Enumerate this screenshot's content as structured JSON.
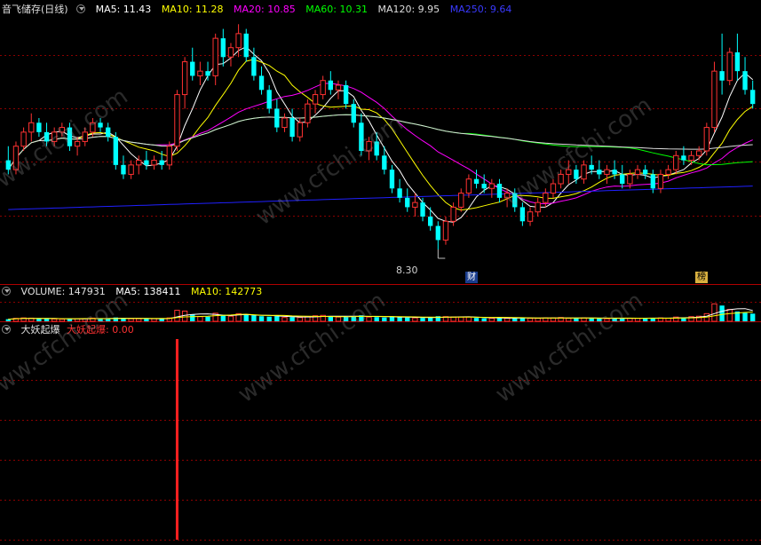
{
  "main_panel": {
    "title": "音飞储存(日线)",
    "ma": [
      {
        "label": "MA5: 11.43",
        "color": "#ffffff"
      },
      {
        "label": "MA10: 11.28",
        "color": "#ffff00"
      },
      {
        "label": "MA20: 10.85",
        "color": "#ff00ff"
      },
      {
        "label": "MA60: 10.31",
        "color": "#00ff00"
      },
      {
        "label": "MA120: 9.95",
        "color": "#dddddd"
      },
      {
        "label": "MA250: 9.64",
        "color": "#2020ff"
      }
    ],
    "low_marker": "8.30",
    "badges": [
      {
        "text": "财"
      },
      {
        "text": "榜"
      }
    ]
  },
  "volume_panel": {
    "label": "VOLUME: 147931",
    "ma5": "MA5: 138411",
    "ma10": "MA10: 142773"
  },
  "indicator_panel": {
    "name": "大妖起爆",
    "value_label": "大妖起爆: 0.00"
  },
  "watermark": "www.cfchi.com",
  "colors": {
    "up": "#ff3232",
    "down": "#00ffff",
    "grid": "#8b0000",
    "ma5": "#ffffff",
    "ma10": "#ffff00",
    "ma20": "#ff00ff",
    "ma60": "#00ff00",
    "ma120": "#dddddd",
    "ma250": "#2020ff"
  },
  "chart_data": {
    "type": "candlestick",
    "price_range": [
      7.6,
      13.2
    ],
    "candles": [
      [
        10.2,
        10.5,
        9.9,
        10.0
      ],
      [
        10.0,
        10.6,
        9.9,
        10.5
      ],
      [
        10.5,
        10.9,
        10.4,
        10.8
      ],
      [
        10.8,
        11.2,
        10.6,
        11.0
      ],
      [
        11.0,
        11.1,
        10.7,
        10.8
      ],
      [
        10.8,
        11.0,
        10.5,
        10.6
      ],
      [
        10.6,
        10.9,
        10.5,
        10.8
      ],
      [
        10.8,
        11.0,
        10.7,
        10.9
      ],
      [
        10.9,
        11.0,
        10.4,
        10.5
      ],
      [
        10.5,
        10.7,
        10.3,
        10.6
      ],
      [
        10.6,
        10.9,
        10.5,
        10.8
      ],
      [
        10.8,
        11.1,
        10.7,
        11.0
      ],
      [
        11.0,
        11.1,
        10.8,
        10.9
      ],
      [
        10.9,
        11.0,
        10.6,
        10.7
      ],
      [
        10.7,
        10.8,
        10.0,
        10.1
      ],
      [
        10.1,
        10.3,
        9.8,
        9.9
      ],
      [
        9.9,
        10.2,
        9.8,
        10.1
      ],
      [
        10.1,
        10.3,
        9.9,
        10.2
      ],
      [
        10.2,
        10.4,
        10.0,
        10.1
      ],
      [
        10.1,
        10.3,
        10.0,
        10.2
      ],
      [
        10.2,
        10.4,
        10.0,
        10.1
      ],
      [
        10.1,
        10.6,
        10.0,
        10.5
      ],
      [
        10.5,
        11.7,
        10.4,
        11.6
      ],
      [
        11.6,
        12.4,
        11.3,
        12.3
      ],
      [
        12.3,
        12.6,
        11.9,
        12.0
      ],
      [
        12.0,
        12.3,
        11.8,
        12.1
      ],
      [
        12.1,
        12.3,
        11.9,
        12.0
      ],
      [
        12.0,
        12.9,
        11.8,
        12.8
      ],
      [
        12.8,
        13.0,
        12.2,
        12.4
      ],
      [
        12.4,
        12.7,
        12.2,
        12.6
      ],
      [
        12.6,
        13.1,
        12.4,
        12.9
      ],
      [
        12.9,
        13.0,
        12.3,
        12.4
      ],
      [
        12.4,
        12.6,
        11.9,
        12.0
      ],
      [
        12.0,
        12.2,
        11.6,
        11.7
      ],
      [
        11.7,
        11.8,
        11.2,
        11.3
      ],
      [
        11.3,
        11.5,
        10.8,
        10.9
      ],
      [
        10.9,
        11.2,
        10.8,
        11.1
      ],
      [
        11.1,
        11.3,
        10.6,
        10.7
      ],
      [
        10.7,
        11.1,
        10.6,
        11.0
      ],
      [
        11.0,
        11.5,
        10.9,
        11.4
      ],
      [
        11.4,
        11.7,
        11.2,
        11.6
      ],
      [
        11.6,
        12.0,
        11.5,
        11.9
      ],
      [
        11.9,
        12.1,
        11.6,
        11.7
      ],
      [
        11.7,
        11.9,
        11.5,
        11.8
      ],
      [
        11.8,
        11.9,
        11.3,
        11.4
      ],
      [
        11.4,
        11.5,
        10.9,
        11.0
      ],
      [
        11.0,
        11.2,
        10.3,
        10.4
      ],
      [
        10.4,
        10.7,
        10.2,
        10.6
      ],
      [
        10.6,
        10.8,
        10.2,
        10.3
      ],
      [
        10.3,
        10.5,
        9.9,
        10.0
      ],
      [
        10.0,
        10.1,
        9.5,
        9.6
      ],
      [
        9.6,
        9.8,
        9.3,
        9.4
      ],
      [
        9.4,
        9.6,
        9.1,
        9.2
      ],
      [
        9.2,
        9.5,
        9.0,
        9.3
      ],
      [
        9.3,
        9.4,
        8.9,
        9.0
      ],
      [
        9.0,
        9.2,
        8.7,
        8.8
      ],
      [
        8.8,
        8.9,
        8.3,
        8.5
      ],
      [
        8.5,
        9.0,
        8.4,
        8.9
      ],
      [
        8.9,
        9.3,
        8.8,
        9.2
      ],
      [
        9.2,
        9.6,
        9.1,
        9.5
      ],
      [
        9.5,
        9.9,
        9.4,
        9.8
      ],
      [
        9.8,
        10.0,
        9.6,
        9.7
      ],
      [
        9.7,
        9.9,
        9.5,
        9.6
      ],
      [
        9.6,
        9.8,
        9.4,
        9.7
      ],
      [
        9.7,
        9.8,
        9.3,
        9.4
      ],
      [
        9.4,
        9.6,
        9.2,
        9.5
      ],
      [
        9.5,
        9.6,
        9.1,
        9.2
      ],
      [
        9.2,
        9.3,
        8.8,
        8.9
      ],
      [
        8.9,
        9.2,
        8.8,
        9.1
      ],
      [
        9.1,
        9.4,
        9.0,
        9.3
      ],
      [
        9.3,
        9.6,
        9.2,
        9.5
      ],
      [
        9.5,
        9.8,
        9.4,
        9.7
      ],
      [
        9.7,
        10.0,
        9.6,
        9.9
      ],
      [
        9.9,
        10.2,
        9.7,
        10.0
      ],
      [
        10.0,
        10.1,
        9.7,
        9.8
      ],
      [
        9.8,
        10.2,
        9.7,
        10.1
      ],
      [
        10.1,
        10.3,
        9.9,
        10.0
      ],
      [
        10.0,
        10.2,
        9.8,
        9.9
      ],
      [
        9.9,
        10.1,
        9.7,
        10.0
      ],
      [
        10.0,
        10.2,
        9.8,
        9.9
      ],
      [
        9.9,
        10.1,
        9.6,
        9.7
      ],
      [
        9.7,
        10.0,
        9.6,
        9.9
      ],
      [
        9.9,
        10.1,
        9.8,
        10.0
      ],
      [
        10.0,
        10.1,
        9.8,
        9.9
      ],
      [
        9.9,
        10.0,
        9.5,
        9.6
      ],
      [
        9.6,
        10.0,
        9.5,
        9.9
      ],
      [
        9.9,
        10.1,
        9.8,
        10.0
      ],
      [
        10.0,
        10.4,
        9.9,
        10.3
      ],
      [
        10.3,
        10.5,
        10.1,
        10.2
      ],
      [
        10.2,
        10.4,
        10.1,
        10.3
      ],
      [
        10.3,
        10.5,
        10.2,
        10.4
      ],
      [
        10.4,
        11.0,
        10.3,
        10.9
      ],
      [
        10.9,
        12.3,
        10.8,
        12.1
      ],
      [
        12.1,
        12.9,
        11.6,
        11.9
      ],
      [
        11.9,
        12.6,
        11.8,
        12.5
      ],
      [
        12.5,
        12.9,
        11.9,
        12.1
      ],
      [
        12.1,
        12.4,
        11.6,
        11.7
      ],
      [
        11.7,
        11.9,
        11.3,
        11.4
      ]
    ],
    "volume_ratio": [
      0.1,
      0.14,
      0.16,
      0.15,
      0.12,
      0.12,
      0.11,
      0.1,
      0.14,
      0.12,
      0.12,
      0.15,
      0.12,
      0.14,
      0.18,
      0.14,
      0.12,
      0.12,
      0.12,
      0.12,
      0.12,
      0.16,
      0.52,
      0.48,
      0.32,
      0.22,
      0.22,
      0.38,
      0.3,
      0.24,
      0.36,
      0.3,
      0.28,
      0.24,
      0.22,
      0.24,
      0.18,
      0.2,
      0.18,
      0.22,
      0.26,
      0.28,
      0.24,
      0.2,
      0.22,
      0.24,
      0.28,
      0.2,
      0.2,
      0.18,
      0.22,
      0.2,
      0.18,
      0.16,
      0.16,
      0.18,
      0.24,
      0.22,
      0.2,
      0.2,
      0.2,
      0.16,
      0.14,
      0.14,
      0.18,
      0.14,
      0.16,
      0.18,
      0.14,
      0.14,
      0.16,
      0.16,
      0.18,
      0.14,
      0.16,
      0.16,
      0.14,
      0.14,
      0.12,
      0.14,
      0.16,
      0.14,
      0.14,
      0.14,
      0.16,
      0.16,
      0.14,
      0.2,
      0.18,
      0.22,
      0.24,
      0.36,
      0.82,
      0.74,
      0.56,
      0.46,
      0.4,
      0.36
    ],
    "indicator_signal_index": 22
  }
}
